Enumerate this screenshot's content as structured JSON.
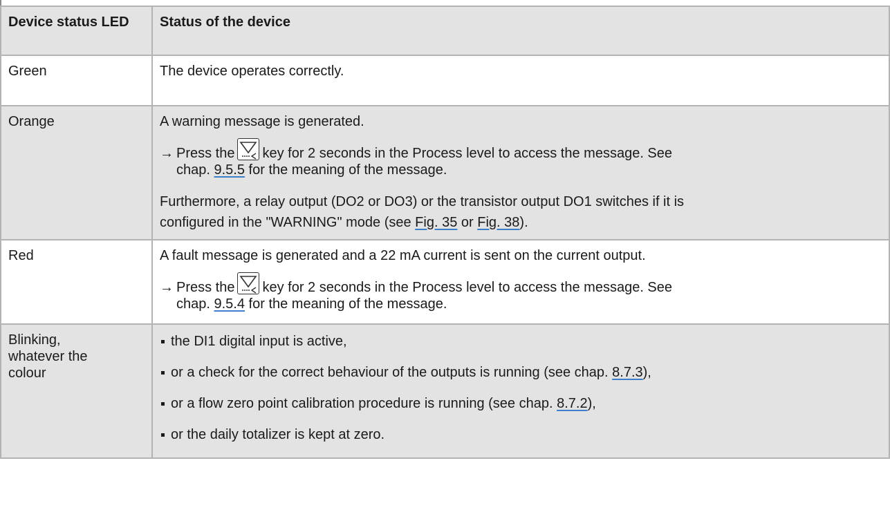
{
  "table": {
    "header": {
      "col1": "Device status LED",
      "col2": "Status of the device"
    },
    "rows": {
      "green": {
        "led": "Green",
        "text": "The device operates correctly."
      },
      "orange": {
        "led": "Orange",
        "p1": "A warning message is generated.",
        "step_prefix": "Press the",
        "step_suffix": "key for 2 seconds in the Process level to access the message. See",
        "step_line2_prefix": "chap.",
        "step_link": "9.5.5",
        "step_line2_suffix": "for the meaning of the message.",
        "p3_line1": "Furthermore, a relay output (DO2 or DO3) or the transistor output DO1 switches if it is",
        "p3_line2_prefix": "configured in the \"WARNING\" mode (see",
        "p3_link1": "Fig. 35",
        "p3_mid": "or",
        "p3_link2": "Fig. 38",
        "p3_end": ")."
      },
      "red": {
        "led": "Red",
        "p1": "A fault message is generated and a 22 mA current is sent on the current output.",
        "step_prefix": "Press the",
        "step_suffix": "key for 2 seconds in the Process level to access the message. See",
        "step_line2_prefix": "chap.",
        "step_link": "9.5.4",
        "step_line2_suffix": "for the meaning of the message."
      },
      "blink": {
        "led_line1": "Blinking,",
        "led_line2": "whatever the",
        "led_line3": "colour",
        "b1": "the DI1 digital input is active,",
        "b2_prefix": "or a check for the correct behaviour of the outputs is running (see chap.",
        "b2_link": "8.7.3",
        "b2_end": "),",
        "b3_prefix": "or a flow zero point calibration procedure is running (see chap.",
        "b3_link": "8.7.2",
        "b3_end": "),",
        "b4": "or the daily totalizer is kept at zero."
      }
    }
  },
  "icons": {
    "arrow": "→",
    "key": "down-arrow-key-icon"
  },
  "colors": {
    "header_bg": "#e3e3e3",
    "border": "#b3b3b3",
    "link_underline": "#3d7ec8"
  }
}
